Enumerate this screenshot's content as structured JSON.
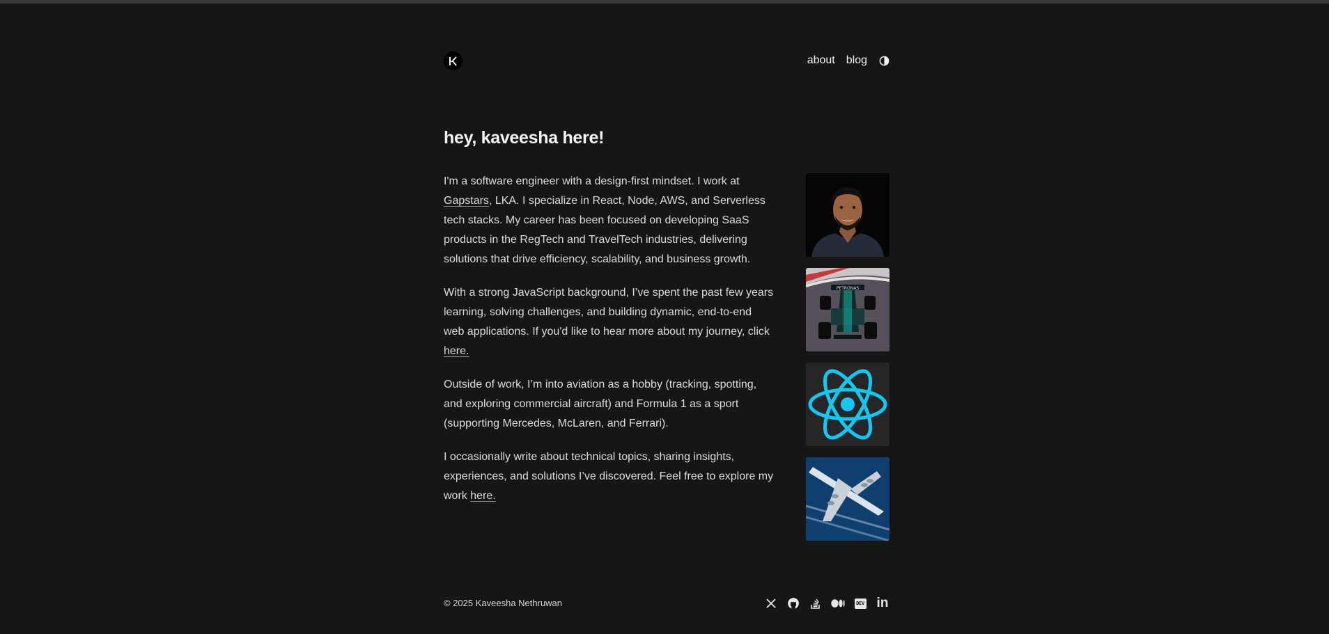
{
  "header": {
    "logo_text": "K",
    "nav": [
      {
        "label": "about"
      },
      {
        "label": "blog"
      }
    ]
  },
  "main": {
    "title": "hey, kaveesha here!",
    "paragraphs": {
      "p1_a": "I'm a software engineer with a design-first mindset. I work at ",
      "p1_link": "Gapstars",
      "p1_b": ", LKA. I specialize in React, Node, AWS, and Serverless tech stacks. My career has been focused on developing SaaS products in the RegTech and TravelTech industries, delivering solutions that drive efficiency, scalability, and business growth.",
      "p2_a": "With a strong JavaScript background, I’ve spent the past few years learning, solving challenges, and building dynamic, end-to-end web applications. If you'd like to hear more about my journey, click ",
      "p2_link": "here.",
      "p3": "Outside of work, I’m into aviation as a hobby (tracking, spotting, and exploring commercial aircraft) and Formula 1 as a sport (supporting Mercedes, McLaren, and Ferrari).",
      "p4_a": "I occasionally write about technical topics, sharing insights, experiences, and solutions I’ve discovered. Feel free to explore my work ",
      "p4_link": "here."
    },
    "gallery": [
      {
        "icon": "portrait-photo"
      },
      {
        "icon": "f1-car-photo"
      },
      {
        "icon": "react-logo-icon"
      },
      {
        "icon": "airplane-photo"
      }
    ]
  },
  "footer": {
    "copyright": "© 2025 Kaveesha Nethruwan",
    "social": [
      "x-icon",
      "github-icon",
      "stackoverflow-icon",
      "medium-icon",
      "dev-icon",
      "linkedin-icon"
    ],
    "dev_label": "DEV",
    "linkedin_label": "in"
  },
  "colors": {
    "background": "#161616",
    "text": "#e6e6e6",
    "react": "#13c7f2",
    "sky": "#0f3f6e"
  }
}
